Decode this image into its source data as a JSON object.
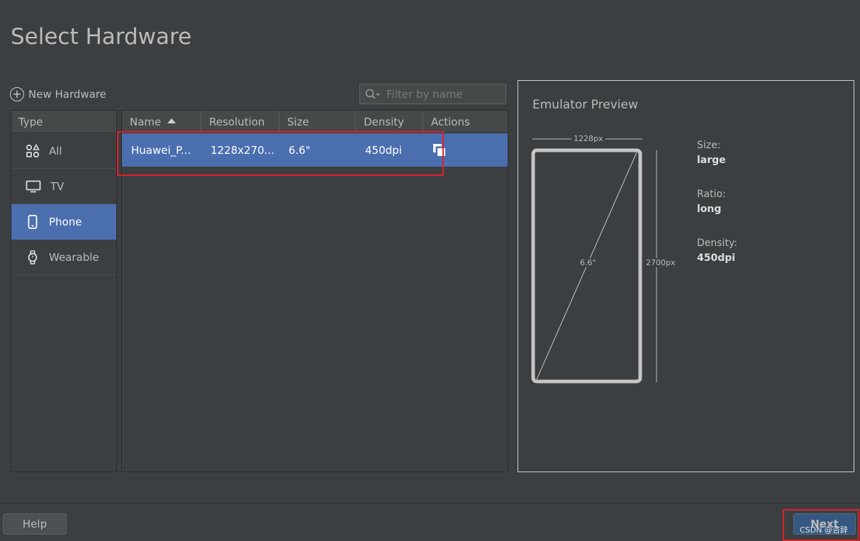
{
  "page": {
    "title": "Select Hardware"
  },
  "toolbar": {
    "new_hardware_label": "New Hardware",
    "filter_placeholder": "Filter by name"
  },
  "type_panel": {
    "header": "Type",
    "items": [
      {
        "label": "All",
        "icon": "all-categories-icon",
        "selected": false
      },
      {
        "label": "TV",
        "icon": "tv-icon",
        "selected": false
      },
      {
        "label": "Phone",
        "icon": "phone-icon",
        "selected": true
      },
      {
        "label": "Wearable",
        "icon": "watch-icon",
        "selected": false
      }
    ]
  },
  "table": {
    "columns": [
      "Name",
      "Resolution",
      "Size",
      "Density",
      "Actions"
    ],
    "sort": {
      "column": "Name",
      "direction": "ascending"
    },
    "rows": [
      {
        "name": "Huawei_P...",
        "resolution": "1228x270...",
        "size": "6.6\"",
        "density": "450dpi",
        "action_icon": "clone-device-icon",
        "selected": true
      }
    ]
  },
  "preview": {
    "title": "Emulator Preview",
    "width_label": "1228px",
    "height_label": "2700px",
    "diagonal_label": "6.6\"",
    "props": [
      {
        "label": "Size:",
        "value": "large"
      },
      {
        "label": "Ratio:",
        "value": "long"
      },
      {
        "label": "Density:",
        "value": "450dpi"
      }
    ]
  },
  "footer": {
    "help_label": "Help",
    "next_label": "Next",
    "watermark": "CSDN @咨辞"
  },
  "colors": {
    "background": "#3c3f41",
    "selection": "#4b6eaf",
    "highlight_box": "#e0202a",
    "next_button": "#365880"
  }
}
